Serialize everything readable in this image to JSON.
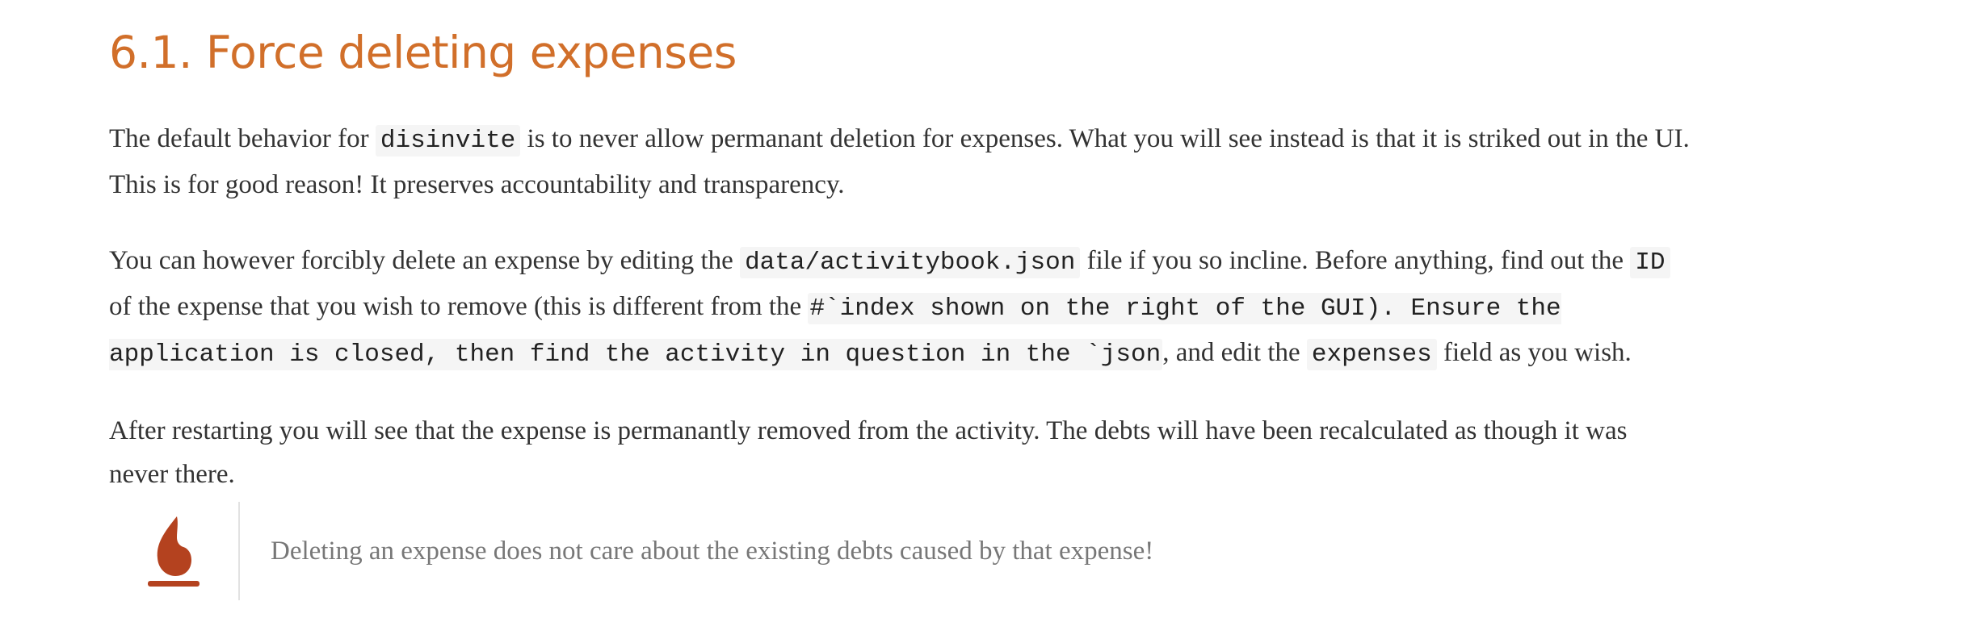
{
  "section": {
    "title": "6.1. Force deleting expenses"
  },
  "paragraph1": {
    "part1": "The default behavior for ",
    "code1": "disinvite",
    "part2": " is to never allow permanant deletion for expenses. What you will see instead is that it is striked out in the UI. This is for good reason! It preserves accountability and transparency."
  },
  "paragraph2": {
    "part1": "You can however forcibly delete an expense by editing the ",
    "code1": "data/activitybook.json",
    "part2": " file if you so incline. Before anything, find out the ",
    "code2": "ID",
    "part3": " of the expense that you wish to remove (this is different from the ",
    "code3": "#`index shown on the right of the GUI). Ensure the application is closed, then find the activity in question in the `json",
    "part4": ", and edit the ",
    "code4": "expenses",
    "part5": " field as you wish."
  },
  "paragraph3": {
    "text": "After restarting you will see that the expense is permanantly removed from the activity. The debts will have been recalculated as though it was never there."
  },
  "admonition": {
    "icon": "flame-icon",
    "icon_color": "#b4421f",
    "text": "Deleting an expense does not care about the existing debts caused by that expense!"
  },
  "colors": {
    "heading": "#d16f2a",
    "body_text": "#333333",
    "note_text": "#777777",
    "code_background": "#f5f5f5"
  }
}
